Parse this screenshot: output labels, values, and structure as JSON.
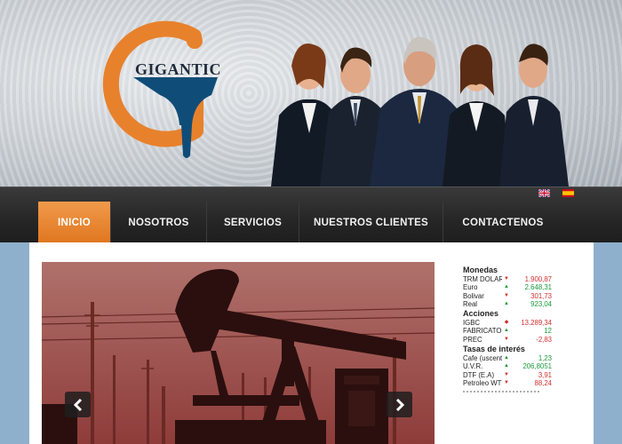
{
  "header": {
    "logo_text": "GIGANTIC"
  },
  "nav": {
    "items": [
      {
        "label": "INICIO",
        "active": true
      },
      {
        "label": "NOSOTROS",
        "active": false
      },
      {
        "label": "SERVICIOS",
        "active": false
      },
      {
        "label": "NUESTROS CLIENTES",
        "active": false
      },
      {
        "label": "CONTACTENOS",
        "active": false
      }
    ],
    "languages": [
      "english-flag-icon",
      "spanish-flag-icon"
    ]
  },
  "slider": {
    "image": "oil-pumpjack-photo",
    "prev_icon": "chevron-left-icon",
    "next_icon": "chevron-right-icon"
  },
  "market": {
    "monedas": {
      "title": "Monedas",
      "rows": [
        {
          "name": "TRM DOLAR",
          "dir": "down",
          "value": "1.900,87"
        },
        {
          "name": "Euro",
          "dir": "up",
          "value": "2.648,31"
        },
        {
          "name": "Bolivar",
          "dir": "down",
          "value": "301,73"
        },
        {
          "name": "Real",
          "dir": "up",
          "value": "923,04"
        }
      ]
    },
    "acciones": {
      "title": "Acciones",
      "rows": [
        {
          "name": "IGBC",
          "dir": "neutral",
          "value": "13.289,34"
        },
        {
          "name": "FABRICATO",
          "dir": "up",
          "value": "12"
        },
        {
          "name": "PREC",
          "dir": "down",
          "value": "-2,83"
        }
      ]
    },
    "tasas": {
      "title": "Tasas de interés",
      "rows": [
        {
          "name": "Cafe (uscent)",
          "dir": "up",
          "value": "1,23"
        },
        {
          "name": "U.V.R.",
          "dir": "up",
          "value": "206,8051"
        },
        {
          "name": "DTF (E.A)",
          "dir": "down",
          "value": "3,91"
        },
        {
          "name": "Petroleo WTI",
          "dir": "down",
          "value": "88,24"
        }
      ]
    }
  },
  "colors": {
    "accent": "#e8812c",
    "nav_bg": "#262626",
    "up": "#1a9a3a",
    "down": "#d23030"
  }
}
